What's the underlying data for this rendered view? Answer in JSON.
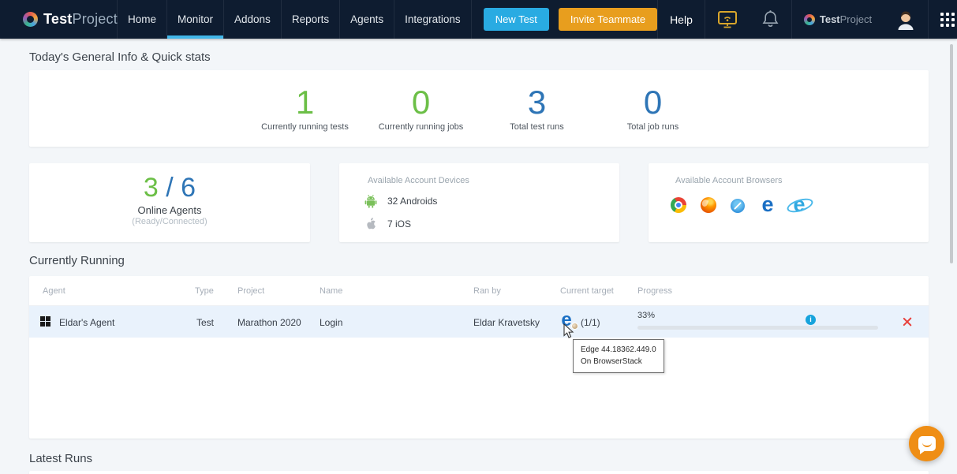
{
  "navbar": {
    "brand": {
      "bold": "Test",
      "light": "Project"
    },
    "items": [
      {
        "label": "Home"
      },
      {
        "label": "Monitor"
      },
      {
        "label": "Addons"
      },
      {
        "label": "Reports"
      },
      {
        "label": "Agents"
      },
      {
        "label": "Integrations"
      }
    ],
    "active_item": "Monitor",
    "new_test": "New Test",
    "invite_teammate": "Invite Teammate",
    "help": "Help",
    "brand_small": {
      "bold": "Test",
      "light": "Project"
    }
  },
  "quick_stats": {
    "heading": "Today's General Info & Quick stats",
    "stats": [
      {
        "value": "1",
        "label": "Currently running tests",
        "color": "#6cbf47"
      },
      {
        "value": "0",
        "label": "Currently running jobs",
        "color": "#6cbf47"
      },
      {
        "value": "3",
        "label": "Total test runs",
        "color": "#2e75b6"
      },
      {
        "value": "0",
        "label": "Total job runs",
        "color": "#2e75b6"
      }
    ]
  },
  "agents_card": {
    "online": "3",
    "slash": " / ",
    "total": "6",
    "title": "Online Agents",
    "subtitle": "(Ready/Connected)"
  },
  "devices_card": {
    "title": "Available Account Devices",
    "android": "32 Androids",
    "ios": "7 iOS"
  },
  "browsers_card": {
    "title": "Available Account Browsers",
    "browsers": [
      "chrome",
      "firefox",
      "safari",
      "edge",
      "internet-explorer"
    ]
  },
  "currently_running": {
    "heading": "Currently Running",
    "columns": [
      "Agent",
      "Type",
      "Project",
      "Name",
      "Ran by",
      "Current target",
      "Progress"
    ],
    "row": {
      "platform": "windows",
      "agent": "Eldar's Agent",
      "type": "Test",
      "project": "Marathon 2020",
      "name": "Login",
      "ran_by": "Eldar Kravetsky",
      "target_browser": "edge",
      "target_count": "(1/1)",
      "progress_label": "33%",
      "progress_style": "width:33%"
    },
    "tooltip": {
      "line1": "Edge 44.18362.449.0",
      "line2": "On BrowserStack"
    }
  },
  "latest_runs": {
    "heading": "Latest Runs"
  },
  "colors": {
    "navbar_bg": "#0e1c30",
    "accent_blue": "#29abe2",
    "accent_orange": "#e89e1e",
    "stat_green": "#6cbf47",
    "stat_blue": "#2e75b6",
    "progress_green": "#26b579",
    "row_highlight": "#e9f2fc",
    "error_red": "#e8413c",
    "active_tab_underline": "#41b6e8",
    "chat_orange": "#ef8e15"
  }
}
